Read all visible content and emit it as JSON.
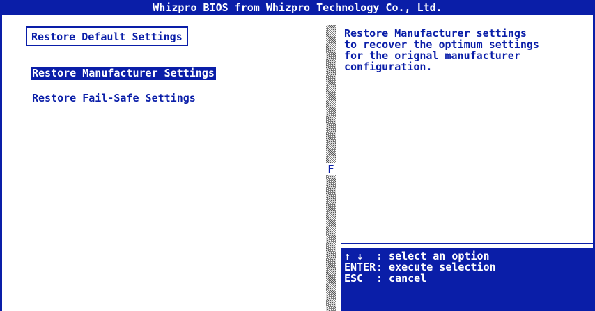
{
  "title": "Whizpro BIOS from Whizpro Technology Co., Ltd.",
  "section_title": "Restore Default Settings",
  "menu": [
    {
      "label": "Restore Manufacturer Settings",
      "selected": true
    },
    {
      "label": "Restore Fail-Safe Settings",
      "selected": false
    }
  ],
  "divider_marker": "F",
  "help": {
    "description": "Restore Manufacturer settings\nto recover the optimum settings\nfor the orignal manufacturer\nconfiguration."
  },
  "keys": [
    {
      "key": "↑ ↓",
      "desc": ": select an option"
    },
    {
      "key": "ENTER",
      "desc": ": execute selection"
    },
    {
      "key": "ESC",
      "desc": ": cancel"
    }
  ],
  "colors": {
    "accent": "#0a1ea8",
    "background": "#ffffff"
  }
}
